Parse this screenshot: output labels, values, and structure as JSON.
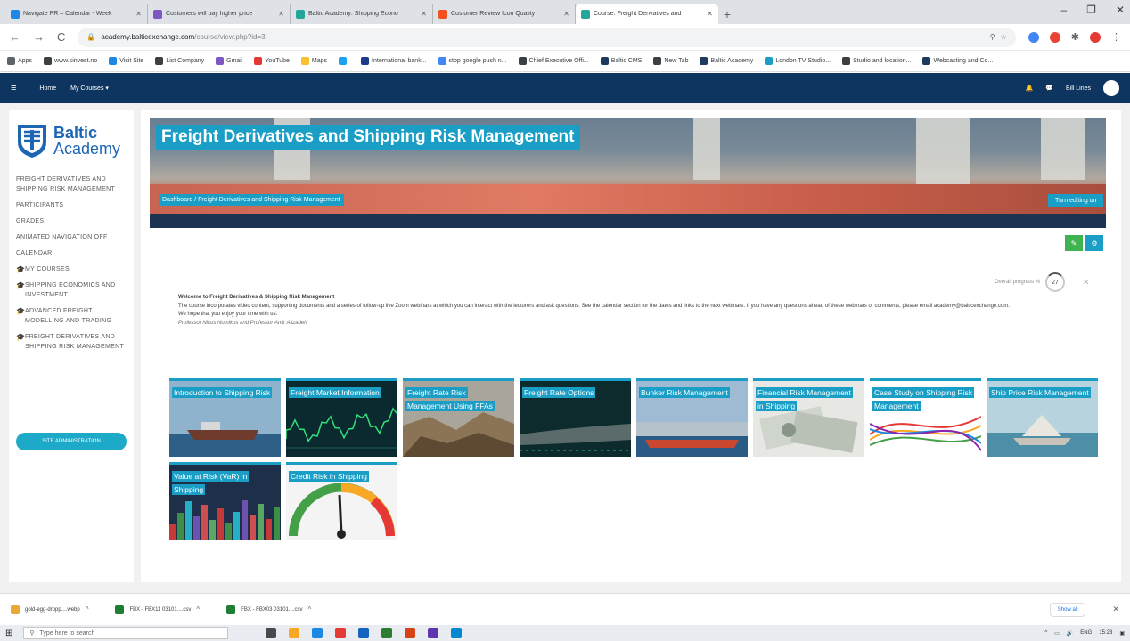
{
  "browser": {
    "tabs": [
      {
        "title": "Navigate PR – Calendar - Week",
        "color": "#1e88e5"
      },
      {
        "title": "Customers will pay higher price",
        "color": "#7e57c2"
      },
      {
        "title": "Baltic Academy: Shipping Econo",
        "color": "#26a69a"
      },
      {
        "title": "Customer Review Icon Quality",
        "color": "#f4511e"
      },
      {
        "title": "Course: Freight Derivatives and",
        "color": "#26a69a",
        "active": true
      }
    ],
    "url_host": "academy.balticexchange.com",
    "url_path": "/course/view.php?id=3",
    "bookmarks": [
      {
        "label": "Apps",
        "color": "#5f6368"
      },
      {
        "label": "www.sinvest.no",
        "color": "#3c4043"
      },
      {
        "label": "Visit Site",
        "color": "#1e88e5"
      },
      {
        "label": "List Company",
        "color": "#3c4043"
      },
      {
        "label": "Gmail",
        "color": "#7e57c2"
      },
      {
        "label": "YouTube",
        "color": "#e53935"
      },
      {
        "label": "Maps",
        "color": "#fbc02d"
      },
      {
        "label": "",
        "color": "#1da1f2"
      },
      {
        "label": "International bank...",
        "color": "#1e3a8a"
      },
      {
        "label": "stop google push n...",
        "color": "#4285f4"
      },
      {
        "label": "Chief Executive Offi...",
        "color": "#3c4043"
      },
      {
        "label": "Baltic CMS",
        "color": "#1e3a5f"
      },
      {
        "label": "New Tab",
        "color": "#3c4043"
      },
      {
        "label": "Baltic Academy",
        "color": "#1e3a5f"
      },
      {
        "label": "London TV Studio...",
        "color": "#1a9ec5"
      },
      {
        "label": "Studio and location...",
        "color": "#3c4043"
      },
      {
        "label": "Webcasting and Co...",
        "color": "#1e3a5f"
      }
    ]
  },
  "sitenav": {
    "home": "Home",
    "my_courses": "My Courses ▾",
    "user": "Bill Lines"
  },
  "logo": {
    "line1": "Baltic",
    "line2": "Academy"
  },
  "leftnav": {
    "items": [
      {
        "label": "FREIGHT DERIVATIVES AND SHIPPING RISK MANAGEMENT",
        "sub": false
      },
      {
        "label": "PARTICIPANTS",
        "sub": false
      },
      {
        "label": "GRADES",
        "sub": false
      },
      {
        "label": "ANIMATED NAVIGATION OFF",
        "sub": false
      },
      {
        "label": "CALENDAR",
        "sub": false
      },
      {
        "label": "MY COURSES",
        "sub": true
      },
      {
        "label": "SHIPPING ECONOMICS AND INVESTMENT",
        "sub": true
      },
      {
        "label": "ADVANCED FREIGHT MODELLING AND TRADING",
        "sub": true
      },
      {
        "label": "FREIGHT DERIVATIVES AND SHIPPING RISK MANAGEMENT",
        "sub": true
      }
    ],
    "site_admin": "SITE ADMINISTRATION"
  },
  "course": {
    "title": "Freight Derivatives and Shipping Risk Management",
    "breadcrumb": "Dashboard / Freight Derivatives and Shipping Risk Management",
    "edit_button": "Turn editing on",
    "progress_label": "Overall progress %",
    "progress_value": "27",
    "welcome_heading": "Welcome to Freight Derivatives & Shipping Risk Management",
    "welcome_p1": "The course incorporates video content, supporting documents and a series of follow-up live Zoom webinars at which you can interact with the lecturers and ask questions. See the calendar section for the dates and links to the next webinars. If you have any questions ahead of these webinars or comments, please email academy@balticexchange.com.",
    "welcome_p2": "We hope that you enjoy your time with us.",
    "welcome_sig": "Professor Nikos Nomikos and Professor Amir Alizadeh"
  },
  "tiles": [
    {
      "label": "Introduction to Shipping Risk",
      "theme": "ship"
    },
    {
      "label": "Freight Market Information",
      "theme": "chart"
    },
    {
      "label": "Freight Rate Risk Management Using FFAs",
      "theme": "rock"
    },
    {
      "label": "Freight Rate Options",
      "theme": "dark"
    },
    {
      "label": "Bunker Risk Management",
      "theme": "harbour"
    },
    {
      "label": "Financial Risk Management in Shipping",
      "theme": "money"
    },
    {
      "label": "Case Study on Shipping Risk Management",
      "theme": "lines"
    },
    {
      "label": "Ship Price Risk Management",
      "theme": "paper"
    },
    {
      "label": "Value at Risk (VaR) in Shipping",
      "theme": "bars"
    },
    {
      "label": "Credit Risk in Shipping",
      "theme": "gauge"
    }
  ],
  "downloads": [
    {
      "name": "gold-egg-dropp....webp",
      "color": "#e8a93a"
    },
    {
      "name": "FBX - FBX11 03101....csv",
      "color": "#1e7e34"
    },
    {
      "name": "FBX - FBX03 03101....csv",
      "color": "#1e7e34"
    }
  ],
  "downloads_show_all": "Show all",
  "taskbar": {
    "search_placeholder": "Type here to search",
    "lang": "ENG",
    "time": "15:23"
  }
}
